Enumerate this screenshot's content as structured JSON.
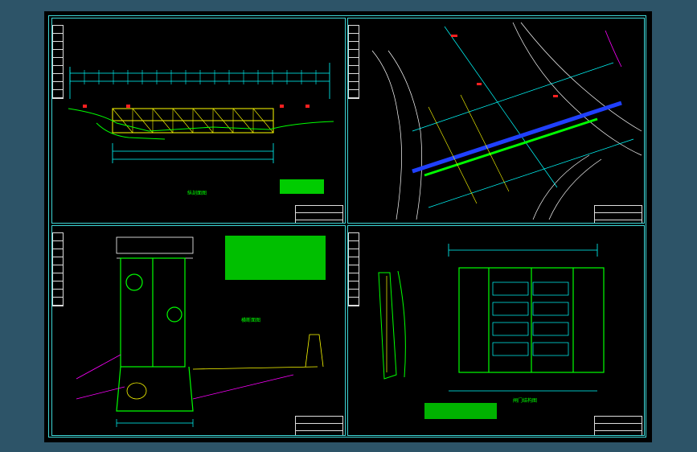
{
  "viewer": {
    "background": "#2d5468",
    "sheet_color": "#000000",
    "frame_color": "#3dd6d6"
  },
  "panels": [
    {
      "id": "elevation",
      "caption": "纵剖面图",
      "title_rows": [
        "",
        "",
        "",
        ""
      ]
    },
    {
      "id": "plan-site",
      "caption": "",
      "title_rows": [
        "",
        "",
        "",
        ""
      ]
    },
    {
      "id": "cross-section",
      "caption": "横断面图",
      "title_rows": [
        "",
        "",
        "",
        ""
      ]
    },
    {
      "id": "gate-detail",
      "caption": "闸门结构图",
      "title_rows": [
        "",
        "",
        "",
        ""
      ]
    }
  ],
  "colors": {
    "cyan": "#00ffff",
    "green": "#00ff00",
    "yellow": "#ffff00",
    "magenta": "#ff00ff",
    "blue": "#2040ff",
    "red": "#ff2020",
    "white": "#ffffff"
  }
}
